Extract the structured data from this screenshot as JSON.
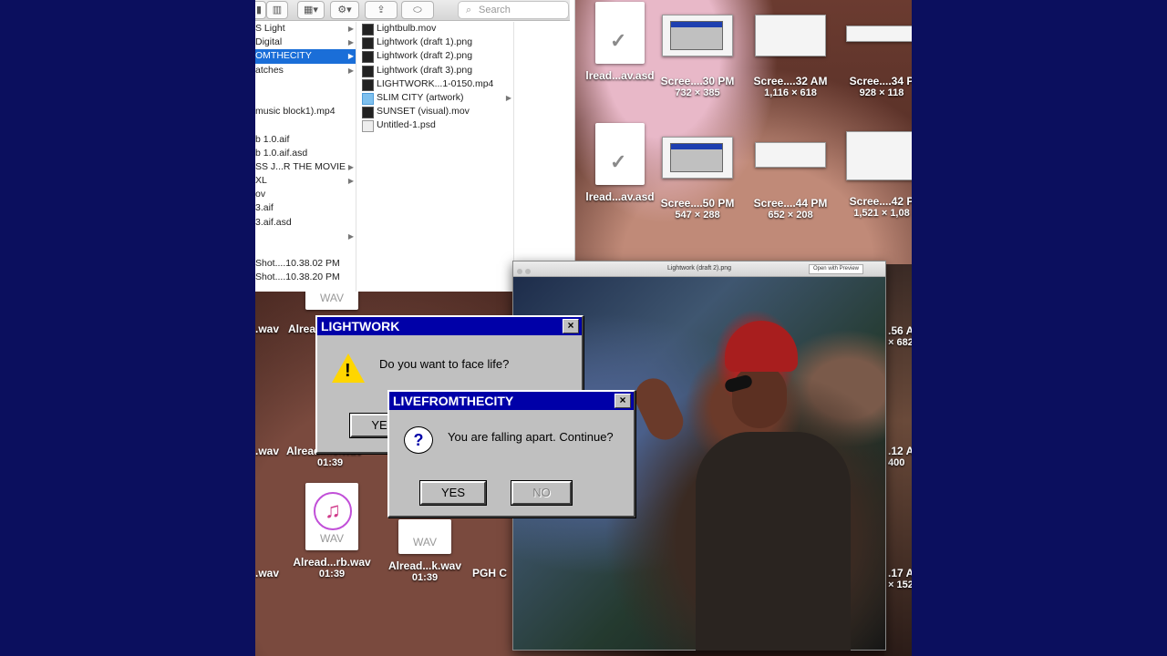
{
  "finder": {
    "search_placeholder": "Search",
    "col1": [
      {
        "label": "S Light",
        "arrow": true
      },
      {
        "label": "Digital",
        "arrow": true
      },
      {
        "label": "OMTHECITY",
        "arrow": true,
        "selected": true
      },
      {
        "label": "atches",
        "arrow": true
      },
      {
        "label": "",
        "arrow": false
      },
      {
        "label": "",
        "arrow": false
      },
      {
        "label": "music block1).mp4",
        "arrow": false
      },
      {
        "label": "",
        "arrow": false
      },
      {
        "label": "b 1.0.aif",
        "arrow": false
      },
      {
        "label": "b 1.0.aif.asd",
        "arrow": false
      },
      {
        "label": "SS J...R THE MOVIE",
        "arrow": true
      },
      {
        "label": "XL",
        "arrow": true
      },
      {
        "label": "ov",
        "arrow": false
      },
      {
        "label": "3.aif",
        "arrow": false
      },
      {
        "label": "3.aif.asd",
        "arrow": false
      },
      {
        "label": "",
        "arrow": true
      },
      {
        "label": "",
        "arrow": false
      },
      {
        "label": "Shot....10.38.02 PM",
        "arrow": false
      },
      {
        "label": "Shot....10.38.20 PM",
        "arrow": false
      }
    ],
    "col2": [
      {
        "label": "Lightbulb.mov",
        "kind": "video"
      },
      {
        "label": "Lightwork (draft 1).png",
        "kind": "image"
      },
      {
        "label": "Lightwork (draft 2).png",
        "kind": "image"
      },
      {
        "label": "Lightwork (draft 3).png",
        "kind": "image"
      },
      {
        "label": "LIGHTWORK...1-0150.mp4",
        "kind": "video"
      },
      {
        "label": "SLIM CITY (artwork)",
        "kind": "folder",
        "arrow": true
      },
      {
        "label": "SUNSET (visual).mov",
        "kind": "video"
      },
      {
        "label": "Untitled-1.psd",
        "kind": "doc"
      }
    ]
  },
  "desktop_icons": {
    "asd1": {
      "label": "lread...av.asd"
    },
    "asd2": {
      "label": "lread...av.asd"
    },
    "shot1": {
      "label": "Scree....30 PM",
      "sub": "732 × 385"
    },
    "shot2": {
      "label": "Scree....32 AM",
      "sub": "1,116 × 618"
    },
    "shot3": {
      "label": "Scree....34 P",
      "sub": "928 × 118"
    },
    "shot4": {
      "label": "Scree....50 PM",
      "sub": "547 × 288"
    },
    "shot5": {
      "label": "Scree....44 PM",
      "sub": "652 × 208"
    },
    "shot6": {
      "label": "Scree....42 P",
      "sub": "1,521 × 1,08"
    },
    "wav_top_left": {
      "label": "WAV"
    },
    "wav_row1_a": {
      "label": ".wav"
    },
    "wav_row1_b": {
      "label": "Alrea"
    },
    "wav_row2_a": {
      "label": ".wav"
    },
    "wav_row2_b": {
      "label": "Alread....c.wav",
      "sub": "01:39"
    },
    "wav_row3_a": {
      "label": ".wav"
    },
    "wav_row3_b": {
      "label": "Alread...rb.wav",
      "sub": "01:39"
    },
    "wav_row3_c": {
      "label": "Alread...k.wav",
      "sub": "01:39"
    },
    "pgh": {
      "label": "PGH C"
    },
    "wav_type": "WAV",
    "right_a": {
      "label": ".56 A",
      "sub": "× 682"
    },
    "right_b": {
      "label": ".12 A",
      "sub": "400"
    },
    "right_c": {
      "label": ".17 A",
      "sub": "× 152"
    }
  },
  "dialog_lightwork": {
    "title": "LIGHTWORK",
    "message": "Do you want to face life?",
    "yes_label": "YE",
    "close": "×"
  },
  "dialog_livefromthecity": {
    "title": "LIVEFROMTHECITY",
    "message": "You are falling apart. Continue?",
    "yes_label": "YES",
    "no_label": "NO",
    "close": "×"
  },
  "preview": {
    "title": "Lightwork (draft 2).png",
    "open_button": "Open with Preview"
  },
  "colors": {
    "win_title": "#0000a8",
    "win_face": "#c0c0c0",
    "finder_selection": "#1a6ed8",
    "background": "#0b0f5e"
  }
}
